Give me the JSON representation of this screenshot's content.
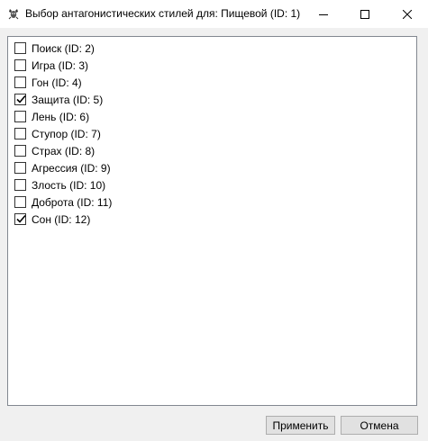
{
  "window": {
    "title": "Выбор антагонистических стилей для: Пищевой (ID: 1)",
    "icon": "app-icon"
  },
  "list": {
    "items": [
      {
        "label": "Поиск (ID: 2)",
        "checked": false
      },
      {
        "label": "Игра (ID: 3)",
        "checked": false
      },
      {
        "label": "Гон (ID: 4)",
        "checked": false
      },
      {
        "label": "Защита (ID: 5)",
        "checked": true
      },
      {
        "label": "Лень (ID: 6)",
        "checked": false
      },
      {
        "label": "Ступор (ID: 7)",
        "checked": false
      },
      {
        "label": "Страх (ID: 8)",
        "checked": false
      },
      {
        "label": "Агрессия (ID: 9)",
        "checked": false
      },
      {
        "label": "Злость (ID: 10)",
        "checked": false
      },
      {
        "label": "Доброта (ID: 11)",
        "checked": false
      },
      {
        "label": "Сон (ID: 12)",
        "checked": true
      }
    ]
  },
  "buttons": {
    "apply_label": "Применить",
    "cancel_label": "Отмена"
  },
  "colors": {
    "window_bg": "#f0f0f0",
    "list_bg": "#ffffff",
    "button_bg": "#e1e1e1"
  }
}
